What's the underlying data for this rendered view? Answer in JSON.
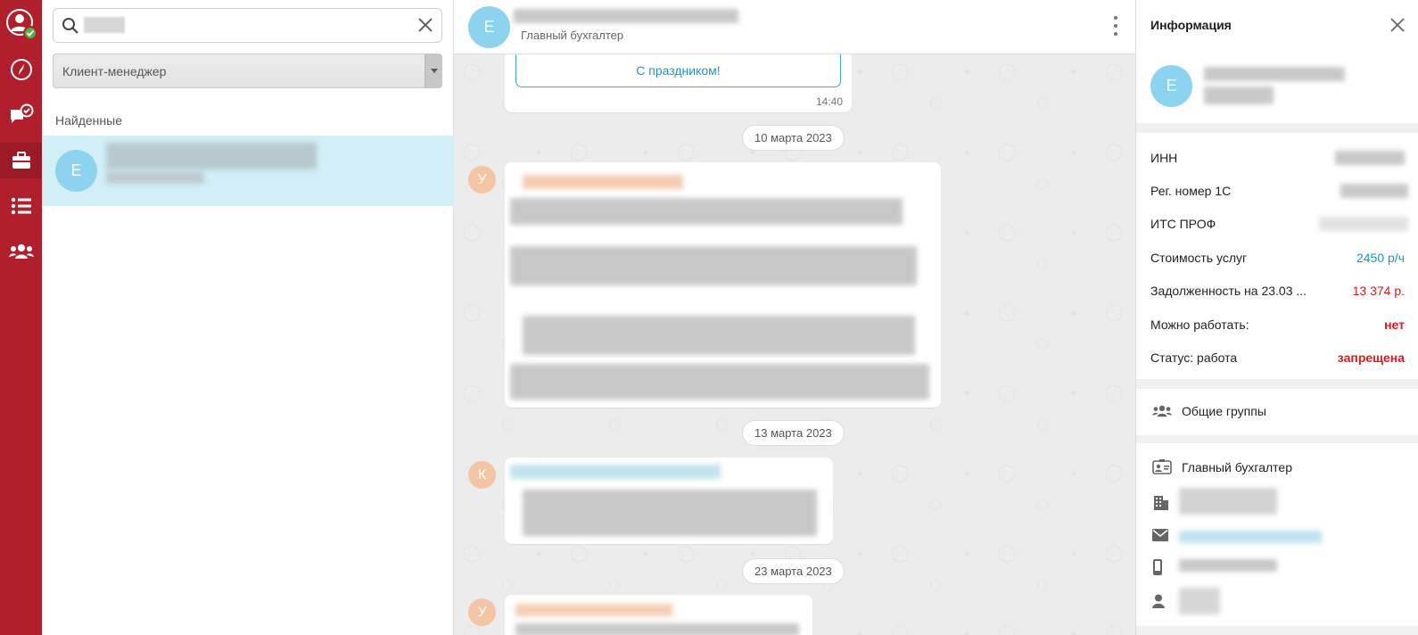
{
  "rail": {
    "items": [
      {
        "name": "profile-status",
        "icon": "user-online-icon"
      },
      {
        "name": "compass",
        "icon": "compass-icon"
      },
      {
        "name": "tasks-chat",
        "icon": "chat-check-icon"
      },
      {
        "name": "clients",
        "icon": "briefcase-icon"
      },
      {
        "name": "lists",
        "icon": "list-icon"
      },
      {
        "name": "groups",
        "icon": "users-group-icon"
      }
    ],
    "bg_color": "#b01f2b"
  },
  "search": {
    "query_value": "",
    "filter_value": "Клиент-менеджер",
    "found_label": "Найденные",
    "result": {
      "avatar_letter": "Е"
    }
  },
  "chat": {
    "header": {
      "avatar_letter": "Е",
      "subtitle": "Главный бухгалтер"
    },
    "messages": {
      "m1": {
        "button_label": "С праздником!",
        "time": "14:40"
      },
      "d1": "10 марта 2023",
      "m2": {
        "avatar_letter": "У"
      },
      "d2": "13 марта 2023",
      "m3": {
        "avatar_letter": "К"
      },
      "d3": "23 марта 2023",
      "m4": {
        "avatar_letter": "У"
      }
    }
  },
  "info": {
    "title": "Информация",
    "avatar_letter": "Е",
    "fields": [
      {
        "label": "ИНН",
        "value": ""
      },
      {
        "label": "Рег. номер 1С",
        "value": ""
      },
      {
        "label": "ИТС ПРОФ",
        "value": ""
      },
      {
        "label": "Стоимость услуг",
        "value": "2450 р/ч"
      },
      {
        "label": "Задолженность на 23.03 ...",
        "value": "13 374 р."
      },
      {
        "label": "Можно работать:",
        "value": "нет"
      },
      {
        "label": "Статус: работа",
        "value": "запрещена"
      }
    ],
    "groups_label": "Общие группы",
    "contact_role": "Главный бухгалтер",
    "colors": {
      "accent_blue": "#1b95c9",
      "alert_red": "#d81c1c",
      "avatar_blue": "#8cd3ef",
      "avatar_peach": "#f4c5a5",
      "selected_row": "#d2eef7"
    }
  }
}
